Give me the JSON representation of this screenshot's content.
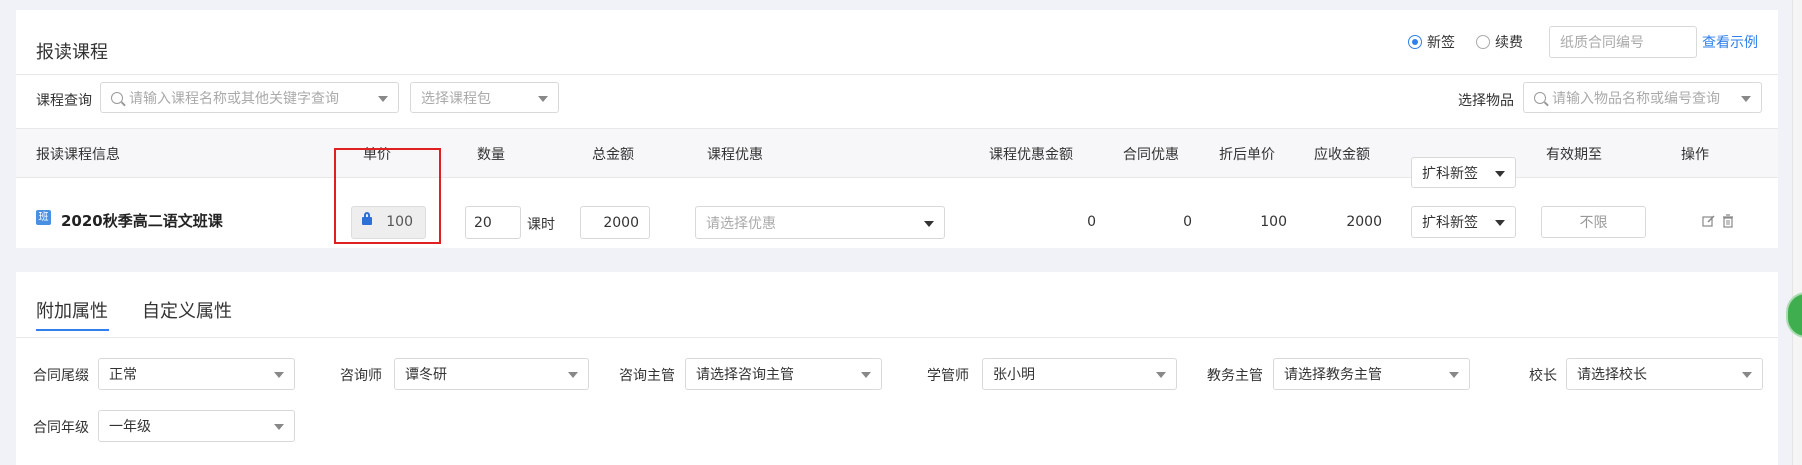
{
  "header": {
    "title": "报读课程",
    "radio_new": "新签",
    "radio_renew": "续费",
    "contract_placeholder": "纸质合同编号",
    "view_example": "查看示例"
  },
  "filters": {
    "course_query_label": "课程查询",
    "course_query_placeholder": "请输入课程名称或其他关键字查询",
    "course_package_placeholder": "选择课程包",
    "item_label": "选择物品",
    "item_placeholder": "请输入物品名称或编号查询"
  },
  "table": {
    "headers": {
      "course_info": "报读课程信息",
      "unit_price": "单价",
      "quantity": "数量",
      "total": "总金额",
      "discount": "课程优惠",
      "discount_amount": "课程优惠金额",
      "contract_discount": "合同优惠",
      "discounted_unit_price": "折后单价",
      "receivable": "应收金额",
      "type_select": "扩科新签",
      "valid_until": "有效期至",
      "actions": "操作"
    },
    "row": {
      "badge": "班",
      "course_name": "2020秋季高二语文班课",
      "unit_price": "100",
      "quantity": "20",
      "unit": "课时",
      "total": "2000",
      "discount_placeholder": "请选择优惠",
      "discount_amount": "0",
      "contract_discount": "0",
      "discounted_unit_price": "100",
      "receivable": "2000",
      "type_select": "扩科新签",
      "valid_until": "不限"
    }
  },
  "tabs": {
    "extra": "附加属性",
    "custom": "自定义属性"
  },
  "attributes": {
    "suffix_label": "合同尾缀",
    "suffix_value": "正常",
    "consultant_label": "咨询师",
    "consultant_value": "谭冬研",
    "consult_supervisor_label": "咨询主管",
    "consult_supervisor_placeholder": "请选择咨询主管",
    "study_manager_label": "学管师",
    "study_manager_value": "张小明",
    "academic_supervisor_label": "教务主管",
    "academic_supervisor_placeholder": "请选择教务主管",
    "principal_label": "校长",
    "principal_placeholder": "请选择校长",
    "grade_label": "合同年级",
    "grade_value": "一年级"
  },
  "colors": {
    "accent": "#2f80ed",
    "highlight": "#e02020",
    "background": "#f0f2f7"
  }
}
